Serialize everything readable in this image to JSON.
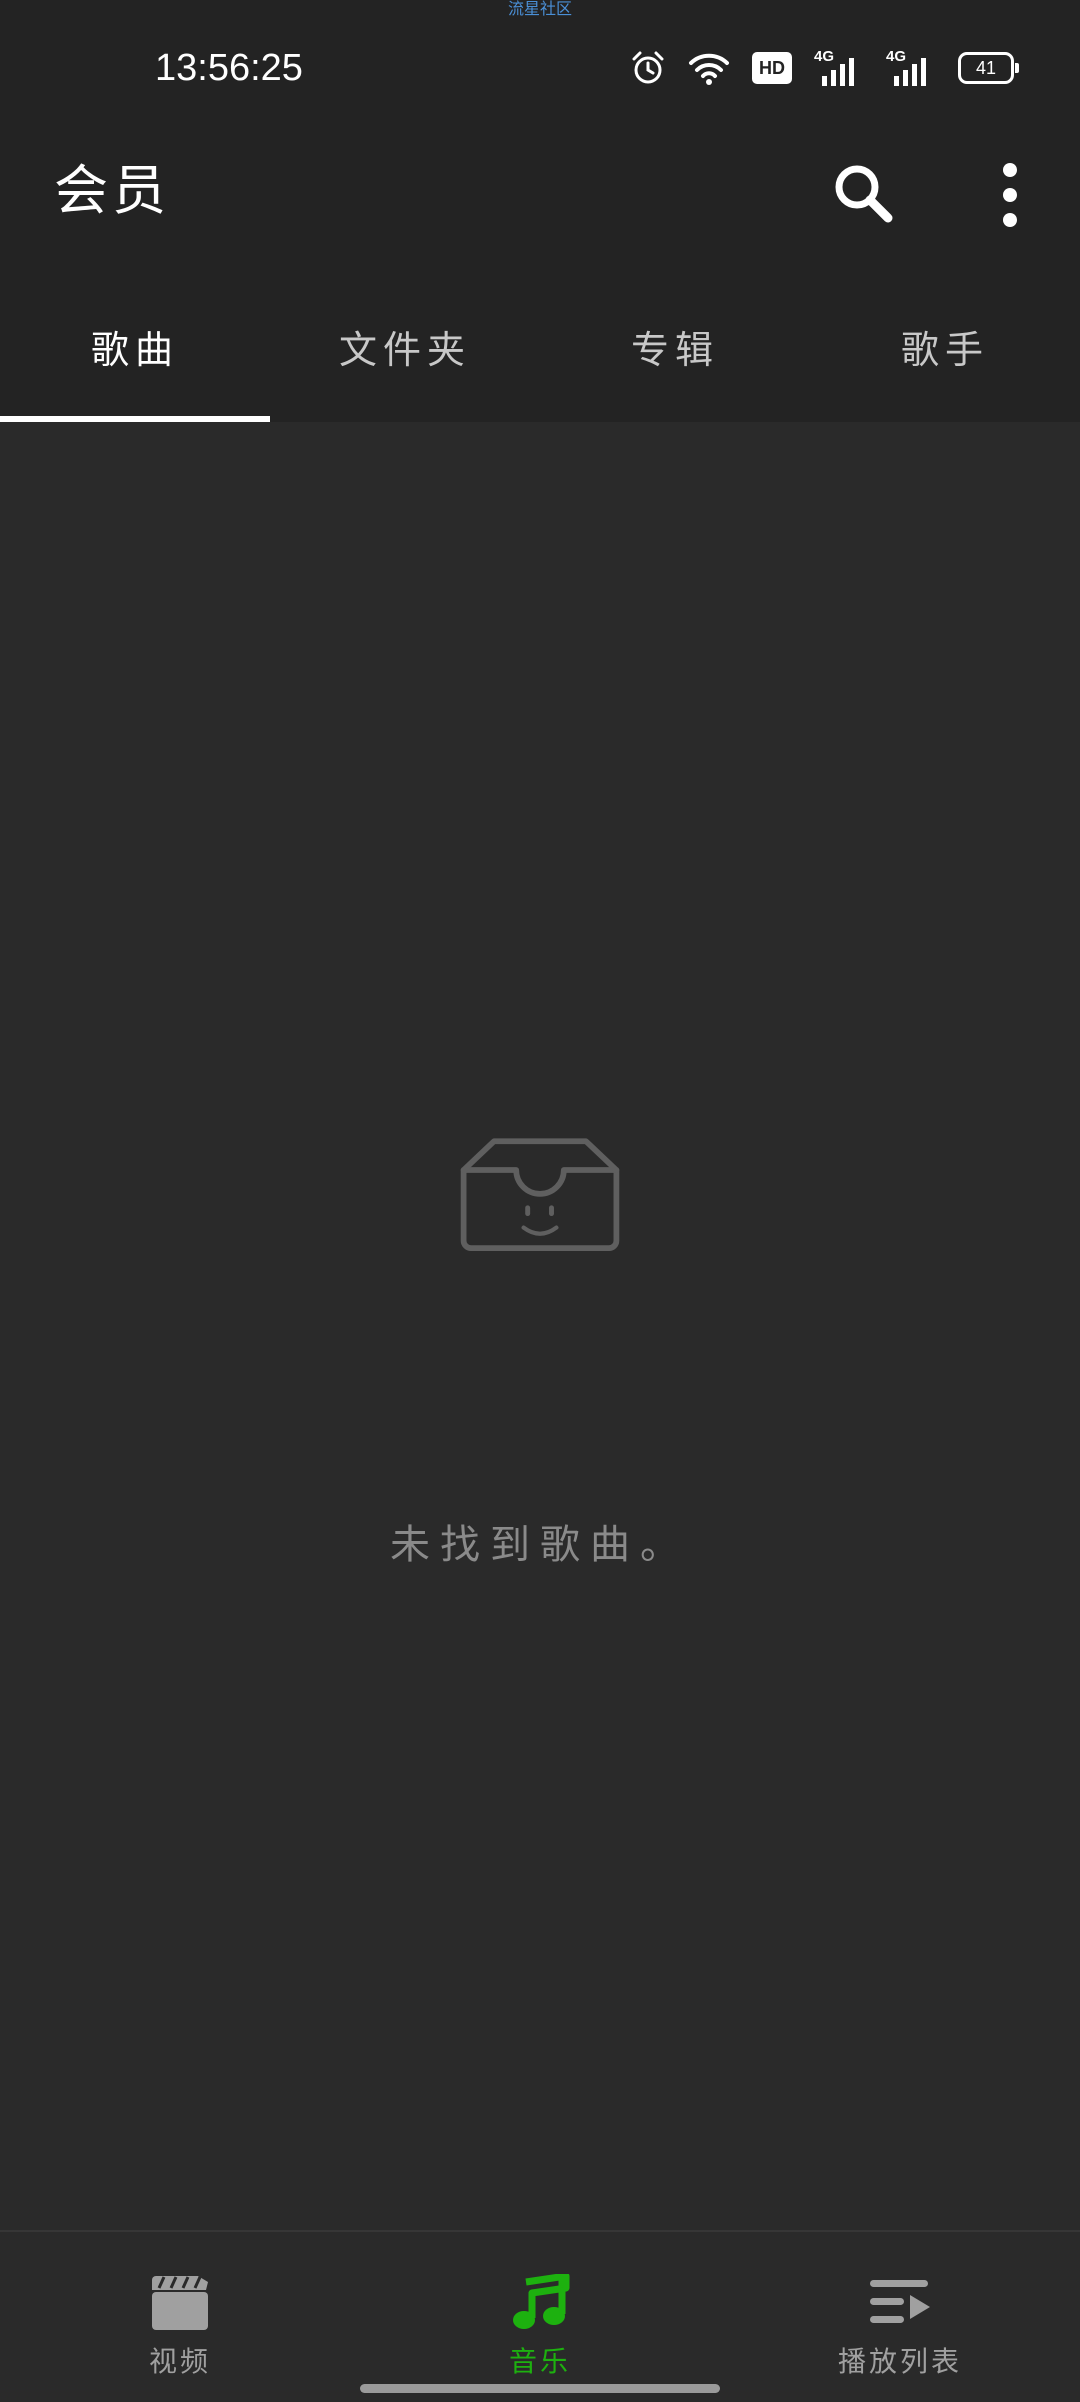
{
  "status_bar": {
    "community_label": "流星社区",
    "time": "13:56:25",
    "icons": [
      "alarm-icon",
      "wifi-icon",
      "hd-icon",
      "cellular-4g-icon",
      "cellular-4g-icon",
      "battery-icon"
    ],
    "hd_label": "HD",
    "network_1": "4G",
    "network_2": "4G",
    "battery_level": "41"
  },
  "app_bar": {
    "title": "会员",
    "search_icon": "search-icon",
    "more_icon": "more-vertical-icon"
  },
  "tabs": [
    {
      "label": "歌曲",
      "active": true
    },
    {
      "label": "文件夹",
      "active": false
    },
    {
      "label": "专辑",
      "active": false
    },
    {
      "label": "歌手",
      "active": false
    }
  ],
  "empty_state": {
    "icon": "empty-box-smile-icon",
    "message": "未找到歌曲。"
  },
  "bottom_nav": [
    {
      "label": "视频",
      "icon": "clapperboard-icon",
      "active": false
    },
    {
      "label": "音乐",
      "icon": "music-note-icon",
      "active": true
    },
    {
      "label": "播放列表",
      "icon": "playlist-play-icon",
      "active": false
    }
  ],
  "colors": {
    "background": "#232323",
    "content_background": "#2a2a2a",
    "accent": "#1db10f",
    "inactive_icon": "#a0a0a0",
    "empty_icon": "#5f5f5f"
  }
}
